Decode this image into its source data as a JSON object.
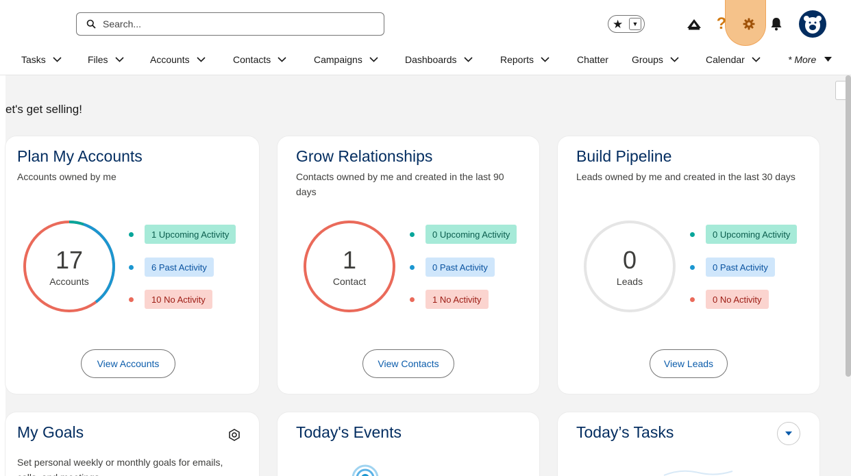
{
  "header": {
    "search_placeholder": "Search...",
    "icons": [
      "search-icon",
      "star-icon",
      "chevron-down-icon",
      "trailhead-icon",
      "help-icon",
      "gear-icon",
      "bell-icon",
      "avatar"
    ]
  },
  "nav": {
    "items": [
      {
        "label": "Tasks",
        "has_menu": true
      },
      {
        "label": "Files",
        "has_menu": true
      },
      {
        "label": "Accounts",
        "has_menu": true
      },
      {
        "label": "Contacts",
        "has_menu": true
      },
      {
        "label": "Campaigns",
        "has_menu": true
      },
      {
        "label": "Dashboards",
        "has_menu": true
      },
      {
        "label": "Reports",
        "has_menu": true
      },
      {
        "label": "Chatter",
        "has_menu": false
      },
      {
        "label": "Groups",
        "has_menu": true
      },
      {
        "label": "Calendar",
        "has_menu": true
      }
    ],
    "more_label": "* More"
  },
  "page": {
    "heading": "et's get selling!"
  },
  "cards": {
    "accounts": {
      "title": "Plan My Accounts",
      "subtitle": "Accounts owned by me",
      "count": "17",
      "count_label": "Accounts",
      "legend": [
        "1 Upcoming Activity",
        "6 Past Activity",
        "10 No Activity"
      ],
      "button": "View Accounts"
    },
    "contacts": {
      "title": "Grow Relationships",
      "subtitle": "Contacts owned by me and created in the last 90 days",
      "count": "1",
      "count_label": "Contact",
      "legend": [
        "0 Upcoming Activity",
        "0 Past Activity",
        "1 No Activity"
      ],
      "button": "View Contacts"
    },
    "leads": {
      "title": "Build Pipeline",
      "subtitle": "Leads owned by me and created in the last 30 days",
      "count": "0",
      "count_label": "Leads",
      "legend": [
        "0 Upcoming Activity",
        "0 Past Activity",
        "0 No Activity"
      ],
      "button": "View Leads"
    },
    "goals": {
      "title": "My Goals",
      "subtitle": "Set personal weekly or monthly goals for emails, calls, and meetings."
    },
    "events": {
      "title": "Today's Events"
    },
    "tasks": {
      "title": "Today’s Tasks"
    }
  },
  "colors": {
    "upcoming": "#06a59a",
    "past": "#1b96d0",
    "none": "#ea6a5a",
    "title": "#032d60",
    "link": "#0b5cab",
    "gear_highlight": "#f5c28a"
  }
}
